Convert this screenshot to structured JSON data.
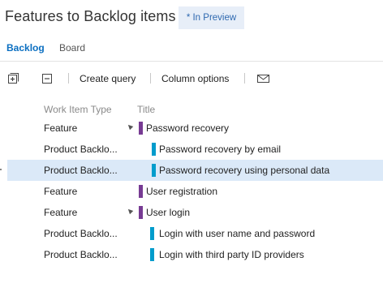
{
  "header": {
    "title": "Features to Backlog items",
    "preview_badge": "* In Preview"
  },
  "tabs": [
    {
      "label": "Backlog",
      "active": true
    },
    {
      "label": "Board",
      "active": false
    }
  ],
  "toolbar": {
    "expand_icon": "expand-all-icon",
    "collapse_icon": "collapse-all-icon",
    "create_query_label": "Create query",
    "column_options_label": "Column options",
    "email_icon": "email-icon"
  },
  "columns": {
    "type_header": "Work Item Type",
    "title_header": "Title"
  },
  "colors": {
    "accent": "#0b6fc1",
    "feature": "#773b93",
    "backlog_item": "#009ccc",
    "selected_row": "#dbe9f8"
  },
  "rows": [
    {
      "type": "Feature",
      "title": "Password recovery",
      "kind": "feature",
      "expanded": true,
      "selected": false
    },
    {
      "type": "Product Backlo...",
      "title": "Password recovery by email",
      "kind": "backlog_item",
      "selected": false
    },
    {
      "type": "Product Backlo...",
      "title": "Password recovery using personal data",
      "kind": "backlog_item",
      "selected": true
    },
    {
      "type": "Feature",
      "title": "User registration",
      "kind": "feature",
      "selected": false
    },
    {
      "type": "Feature",
      "title": "User login",
      "kind": "feature",
      "expanded": true,
      "selected": false
    },
    {
      "type": "Product Backlo...",
      "title": "Login with user name and password",
      "kind": "backlog_item",
      "selected": false
    },
    {
      "type": "Product Backlo...",
      "title": "Login with third party ID providers",
      "kind": "backlog_item",
      "selected": false
    }
  ]
}
